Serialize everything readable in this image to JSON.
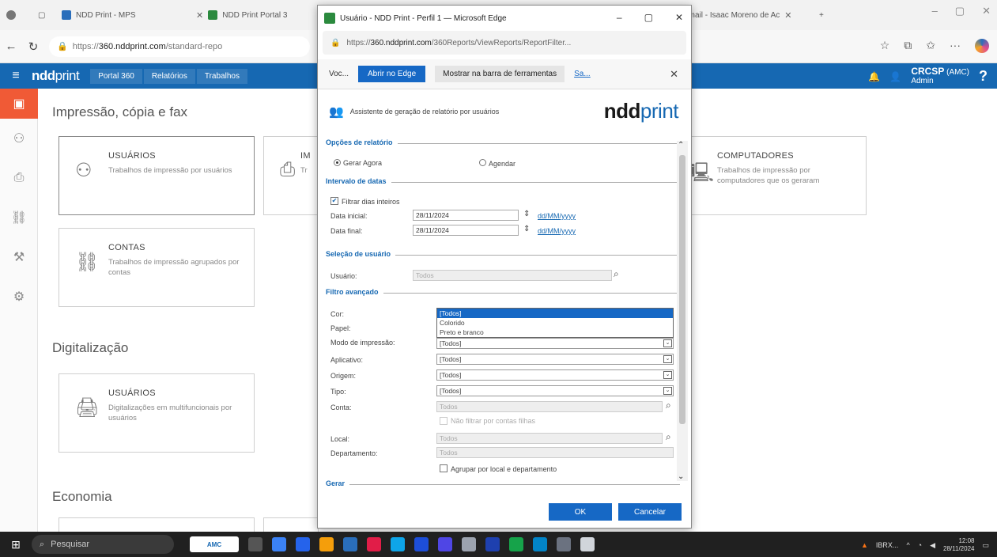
{
  "browser": {
    "tabs": [
      {
        "label": "NDD Print - MPS"
      },
      {
        "label": "NDD Print Portal 3"
      },
      {
        "label": "Email - Isaac Moreno de Ac"
      }
    ],
    "url_prefix": "https://",
    "url_host": "360.nddprint.com",
    "url_path": "/standard-repo"
  },
  "app": {
    "brand_bold": "ndd",
    "brand_light": "print",
    "breadcrumb": [
      "Portal 360",
      "Relatórios",
      "Trabalhos"
    ],
    "user_org": "CRCSP",
    "user_tag": "(AMC)",
    "user_role": "Admin",
    "help": "?"
  },
  "main": {
    "sections": [
      {
        "title": "Impressão, cópia e fax"
      },
      {
        "title": "Digitalização"
      },
      {
        "title": "Economia"
      }
    ],
    "cards": [
      {
        "title": "USUÁRIOS",
        "desc": "Trabalhos de impressão por usuários",
        "icon": "users-icon"
      },
      {
        "title": "CONTAS",
        "desc": "Trabalhos de impressão agrupados por contas",
        "icon": "accounts-icon"
      },
      {
        "title": "COMPUTADORES",
        "desc": "Trabalhos de impressão por computadores que os geraram",
        "icon": "computer-icon"
      },
      {
        "title": "USUÁRIOS",
        "desc": "Digitalizações em multifuncionais por usuários",
        "icon": "scanner-icon"
      },
      {
        "title": "IM",
        "desc": "Tr",
        "icon": "printer-icon"
      }
    ]
  },
  "popup": {
    "title": "Usuário - NDD Print - Perfil 1 — Microsoft Edge",
    "url_prefix": "https://",
    "url_host": "360.nddprint.com",
    "url_path": "/360Reports/ViewReports/ReportFilter...",
    "infobar_text": "Voc...",
    "open_edge": "Abrir no Edge",
    "show_bar": "Mostrar na barra de ferramentas",
    "sa_link": "Sa...",
    "wizard_text": "Assistente de geração de relatório por usuários",
    "logo_bold": "ndd",
    "logo_light": "print",
    "groups": {
      "options": "Opções de relatório",
      "dates": "Intervalo de datas",
      "user_sel": "Seleção de usuário",
      "advanced": "Filtro avançado",
      "generate": "Gerar"
    },
    "radio_now": "Gerar Agora",
    "radio_schedule": "Agendar",
    "filter_days": "Filtrar dias inteiros",
    "start_label": "Data inicial:",
    "start_value": "28/11/2024",
    "end_label": "Data final:",
    "end_value": "28/11/2024",
    "date_format": "dd/MM/yyyy",
    "user_label": "Usuário:",
    "user_placeholder": "Todos",
    "color_label": "Cor:",
    "paper_label": "Papel:",
    "print_mode_label": "Modo de impressão:",
    "app_label": "Aplicativo:",
    "origin_label": "Origem:",
    "type_label": "Tipo:",
    "account_label": "Conta:",
    "no_filter_child": "Não filtrar por contas filhas",
    "local_label": "Local:",
    "dept_label": "Departamento:",
    "group_by": "Agrupar por local e departamento",
    "all": "[Todos]",
    "all_dis": "Todos",
    "color_options": [
      "[Todos]",
      "Colorido",
      "Preto e branco"
    ],
    "ok": "OK",
    "cancel": "Cancelar"
  },
  "taskbar": {
    "search": "Pesquisar",
    "amc": "AMC",
    "ticker": "IBRX...",
    "time": "12:08",
    "date": "28/11/2024"
  },
  "colors": {
    "accent": "#1668b2",
    "active_rail": "#f05a36"
  }
}
